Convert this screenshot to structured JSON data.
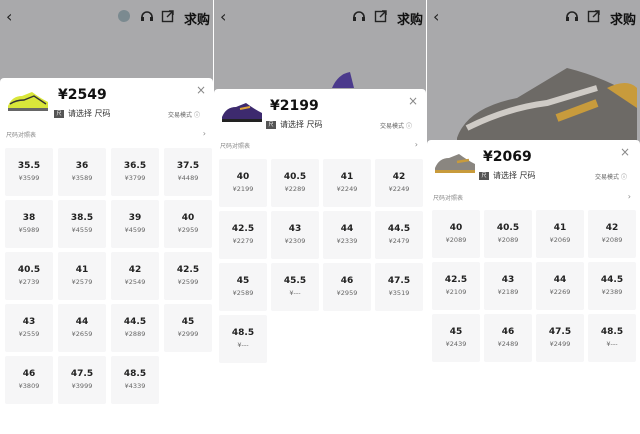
{
  "common": {
    "back_icon": "‹",
    "headset_icon": "headset-icon",
    "share_icon": "share-icon",
    "buy_label": "求购",
    "select_label": "请选择 尺码",
    "trade_mode": "交易模式",
    "size_chart": "尺码对照表",
    "close_icon": "×"
  },
  "panels": [
    {
      "price": "¥2549",
      "sizes": [
        {
          "size": "35.5",
          "price": "¥3599"
        },
        {
          "size": "36",
          "price": "¥3589"
        },
        {
          "size": "36.5",
          "price": "¥3799"
        },
        {
          "size": "37.5",
          "price": "¥4489"
        },
        {
          "size": "38",
          "price": "¥5989"
        },
        {
          "size": "38.5",
          "price": "¥4559"
        },
        {
          "size": "39",
          "price": "¥4599"
        },
        {
          "size": "40",
          "price": "¥2959"
        },
        {
          "size": "40.5",
          "price": "¥2739"
        },
        {
          "size": "41",
          "price": "¥2579"
        },
        {
          "size": "42",
          "price": "¥2549"
        },
        {
          "size": "42.5",
          "price": "¥2599"
        },
        {
          "size": "43",
          "price": "¥2559"
        },
        {
          "size": "44",
          "price": "¥2659"
        },
        {
          "size": "44.5",
          "price": "¥2889"
        },
        {
          "size": "45",
          "price": "¥2999"
        },
        {
          "size": "46",
          "price": "¥3809"
        },
        {
          "size": "47.5",
          "price": "¥3999"
        },
        {
          "size": "48.5",
          "price": "¥4339"
        }
      ]
    },
    {
      "price": "¥2199",
      "sizes": [
        {
          "size": "40",
          "price": "¥2199"
        },
        {
          "size": "40.5",
          "price": "¥2289"
        },
        {
          "size": "41",
          "price": "¥2249"
        },
        {
          "size": "42",
          "price": "¥2249"
        },
        {
          "size": "42.5",
          "price": "¥2279"
        },
        {
          "size": "43",
          "price": "¥2309"
        },
        {
          "size": "44",
          "price": "¥2339"
        },
        {
          "size": "44.5",
          "price": "¥2479"
        },
        {
          "size": "45",
          "price": "¥2589"
        },
        {
          "size": "45.5",
          "price": "¥---"
        },
        {
          "size": "46",
          "price": "¥2959"
        },
        {
          "size": "47.5",
          "price": "¥3519"
        },
        {
          "size": "48.5",
          "price": "¥---"
        }
      ]
    },
    {
      "price": "¥2069",
      "sizes": [
        {
          "size": "40",
          "price": "¥2089"
        },
        {
          "size": "40.5",
          "price": "¥2089"
        },
        {
          "size": "41",
          "price": "¥2069"
        },
        {
          "size": "42",
          "price": "¥2089"
        },
        {
          "size": "42.5",
          "price": "¥2109"
        },
        {
          "size": "43",
          "price": "¥2189"
        },
        {
          "size": "44",
          "price": "¥2269"
        },
        {
          "size": "44.5",
          "price": "¥2389"
        },
        {
          "size": "45",
          "price": "¥2439"
        },
        {
          "size": "46",
          "price": "¥2489"
        },
        {
          "size": "47.5",
          "price": "¥2499"
        },
        {
          "size": "48.5",
          "price": "¥---"
        }
      ]
    }
  ]
}
